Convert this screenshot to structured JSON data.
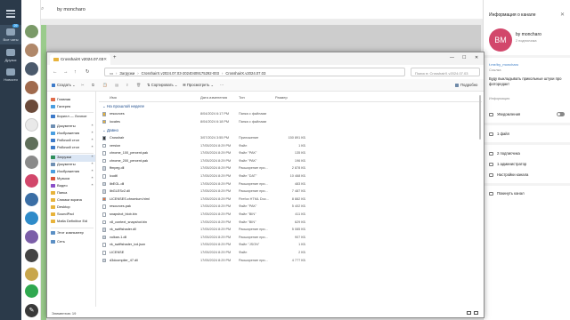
{
  "telegram": {
    "folders": [
      {
        "label": "Все чаты",
        "badge": "29"
      },
      {
        "label": "Друзья",
        "badge": ""
      },
      {
        "label": "Новости",
        "badge": ""
      }
    ],
    "header_name": "by moncharo"
  },
  "channel_info": {
    "title": "Информация о канале",
    "avatar_initials": "BM",
    "name": "by moncharo",
    "subscribers_line": "2 подписчика",
    "link": "t.me/by_moncharo",
    "link_caption": "Ссылка",
    "description": "Буду выкладывать прикольные штуки про фоторедакт",
    "description_caption": "Информация",
    "notifications_label": "Уведомления",
    "files_label": "1 файл",
    "members_label": "2 подписчика",
    "admins_label": "1 администратор",
    "settings_label": "Настройки канала",
    "leave_label": "Покинуть канал"
  },
  "explorer": {
    "tab_title": "CrosshairX v2024.07.03",
    "address": [
      "Загрузки",
      "CrosshairX.v2024.07.03-20240409175292-003",
      "CrosshairX.v2024.07.03"
    ],
    "search_placeholder": "Поиск в: CrosshairX.v2024.07.03",
    "toolbar": {
      "create": "Создать",
      "sort": "Сортировать",
      "view": "Просмотреть",
      "details": "Подробно"
    },
    "columns": {
      "name": "Имя",
      "date": "Дата изменения",
      "type": "Тип",
      "size": "Размер"
    },
    "groups": {
      "last_week": "На прошлой неделе",
      "earlier": "Давно"
    },
    "nav_pane": [
      {
        "label": "Главная",
        "icon_color": "#e06c4a",
        "pin": false
      },
      {
        "label": "Галерея",
        "icon_color": "#4a9ee0",
        "pin": false
      },
      {
        "label": "Кирилл — Личное",
        "icon_color": "#3c7ac9",
        "pin": false
      },
      {
        "label": "Документы",
        "icon_color": "#6e8fb3",
        "pin": true
      },
      {
        "label": "Изображения",
        "icon_color": "#4a9ee0",
        "pin": true
      },
      {
        "label": "Рабочий стол",
        "icon_color": "#3c7ac9",
        "pin": true
      },
      {
        "label": "Рабочий стол",
        "icon_color": "#3c7ac9",
        "pin": true
      },
      {
        "label": "Загрузки",
        "icon_color": "#2f8f5b",
        "pin": true
      },
      {
        "label": "Документы",
        "icon_color": "#6e8fb3",
        "pin": true
      },
      {
        "label": "Изображения",
        "icon_color": "#4a9ee0",
        "pin": true
      },
      {
        "label": "Музыка",
        "icon_color": "#d9533b",
        "pin": true
      },
      {
        "label": "Видео",
        "icon_color": "#8a4fc9",
        "pin": true
      },
      {
        "label": "Папка",
        "icon_color": "#e8b33b",
        "pin": false
      },
      {
        "label": "Снимки экрана",
        "icon_color": "#e8b33b",
        "pin": false
      },
      {
        "label": "Desktop",
        "icon_color": "#e8b33b",
        "pin": false
      },
      {
        "label": "SoundPad",
        "icon_color": "#e8b33b",
        "pin": false
      },
      {
        "label": "Mafia Definitive Edi",
        "icon_color": "#e8b33b",
        "pin": false
      },
      {
        "label": "Этот компьютер",
        "icon_color": "#5b8fc4",
        "pin": false
      },
      {
        "label": "Сеть",
        "icon_color": "#5b8fc4",
        "pin": false
      }
    ],
    "files_last_week": [
      {
        "name": "resources",
        "date": "8/04/2024 6:17 PM",
        "type": "Папка с файлами",
        "size": "",
        "icon_color": "#e8b33b"
      },
      {
        "name": "locales",
        "date": "8/04/2024 6:18 PM",
        "type": "Папка с файлами",
        "size": "",
        "icon_color": "#e8b33b"
      }
    ],
    "files_earlier": [
      {
        "name": "Crosshair",
        "date": "3/07/2024 3:55 PM",
        "type": "Приложение",
        "size": "150 891 КБ",
        "icon_color": "#333333"
      },
      {
        "name": "version",
        "date": "17/05/2024 8:29 PM",
        "type": "Файл",
        "size": "1 КБ",
        "icon_color": "#ffffff"
      },
      {
        "name": "chrome_100_percent.pak",
        "date": "17/05/2024 8:29 PM",
        "type": "Файл \"PAK\"",
        "size": "135 КБ",
        "icon_color": "#ffffff"
      },
      {
        "name": "chrome_200_percent.pak",
        "date": "17/05/2024 8:29 PM",
        "type": "Файл \"PAK\"",
        "size": "196 КБ",
        "icon_color": "#ffffff"
      },
      {
        "name": "ffmpeg.dll",
        "date": "17/05/2024 8:29 PM",
        "type": "Расширение при...",
        "size": "2 878 КБ",
        "icon_color": "#cfd6de"
      },
      {
        "name": "icudtl",
        "date": "17/05/2024 8:29 PM",
        "type": "Файл \"DAT\"",
        "size": "10 468 КБ",
        "icon_color": "#ffffff"
      },
      {
        "name": "libEGL.dll",
        "date": "17/05/2024 8:29 PM",
        "type": "Расширение при...",
        "size": "483 КБ",
        "icon_color": "#cfd6de"
      },
      {
        "name": "libGLESv2.dll",
        "date": "17/05/2024 8:29 PM",
        "type": "Расширение при...",
        "size": "7 487 КБ",
        "icon_color": "#cfd6de"
      },
      {
        "name": "LICENSES.chromium.html",
        "date": "17/05/2024 8:29 PM",
        "type": "Firefox HTML Doc...",
        "size": "8 882 КБ",
        "icon_color": "#e8743b"
      },
      {
        "name": "resources.pak",
        "date": "17/05/2024 8:29 PM",
        "type": "Файл \"PAK\"",
        "size": "5 402 КБ",
        "icon_color": "#ffffff"
      },
      {
        "name": "snapshot_blob.bin",
        "date": "17/05/2024 8:29 PM",
        "type": "Файл \"BIN\"",
        "size": "411 КБ",
        "icon_color": "#ffffff"
      },
      {
        "name": "v8_context_snapshot.bin",
        "date": "17/05/2024 8:29 PM",
        "type": "Файл \"BIN\"",
        "size": "629 КБ",
        "icon_color": "#ffffff"
      },
      {
        "name": "vk_swiftshader.dll",
        "date": "17/05/2024 8:29 PM",
        "type": "Расширение при...",
        "size": "5 085 КБ",
        "icon_color": "#cfd6de"
      },
      {
        "name": "vulkan-1.dll",
        "date": "17/05/2024 8:29 PM",
        "type": "Расширение при...",
        "size": "907 КБ",
        "icon_color": "#cfd6de"
      },
      {
        "name": "vk_swiftshader_icd.json",
        "date": "17/05/2024 8:29 PM",
        "type": "Файл \"JSON\"",
        "size": "1 КБ",
        "icon_color": "#ffffff"
      },
      {
        "name": "LICENSE",
        "date": "17/05/2024 8:29 PM",
        "type": "Файл",
        "size": "2 КБ",
        "icon_color": "#ffffff"
      },
      {
        "name": "d3dcompiler_47.dll",
        "date": "17/05/2024 8:29 PM",
        "type": "Расширение при...",
        "size": "4 777 КБ",
        "icon_color": "#cfd6de"
      }
    ],
    "status": "Элементов: 19"
  }
}
